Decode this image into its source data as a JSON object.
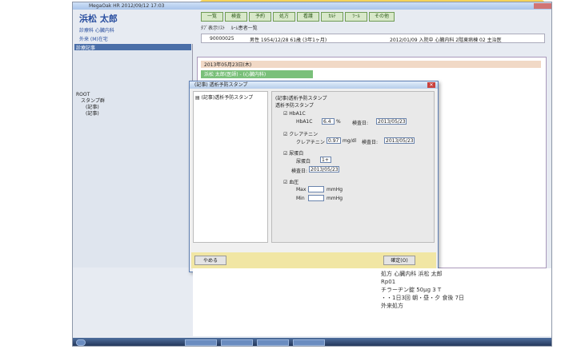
{
  "window": {
    "title": "MegaOak HR  2012/09/12 17:03"
  },
  "patient": {
    "name": "浜松 太郎",
    "dept": "診療科 心臓内科",
    "sub": "外来 (M)在宅"
  },
  "tabs": [
    "一覧",
    "検査",
    "予約",
    "処方",
    "看護",
    "ｶﾙﾃ",
    "ﾂｰﾙ",
    "その他"
  ],
  "row2": {
    "a": "ﾀﾌﾞ表示ﾘｽﾄ",
    "b": "ﾙｰﾑ患者一覧"
  },
  "patientbar": {
    "id": "90000025",
    "info": "男性 1954/12/28 61歳 (3年1ヶ月)",
    "extra": "2012/01/09 入院中  心臓内科 2階東病棟 02  主治医"
  },
  "left": {
    "header": "診療記事",
    "tree": [
      "ROOT",
      "スタンプ群",
      "(記事)",
      "(記事)"
    ]
  },
  "editor": {
    "date": "2013年05月23日(木)",
    "tab": "浜松 太郎(医師) - (心臓内科)"
  },
  "dialog": {
    "title": "(記事) 透析予防スタンプ",
    "tree_item": "(記事)透析予防スタンプ",
    "form_title": "(記事)透析予防スタンプ",
    "section": "透析予防スタンプ",
    "hba1c_label": "HbA1C",
    "hba1c_sub": "HbA1C",
    "hba1c_val": "6.4",
    "hba1c_unit": "%",
    "exam_label": "検査日:",
    "hba1c_date": "2013/05/23",
    "cre_label": "クレアチニン",
    "cre_sub": "クレアチニン",
    "cre_val": "0.97",
    "cre_unit": "mg/dl",
    "cre_date": "2013/05/23",
    "urine_label": "尿蛋白",
    "urine_sub": "尿蛋白",
    "urine_val": "1+",
    "urine_date": "2013/05/23",
    "bp_label": "血圧",
    "max_label": "Max",
    "min_label": "Min",
    "bp_unit": "mmHg",
    "cancel": "やめる",
    "confirm": "確定(O)"
  },
  "prescription": {
    "lines": [
      "処方  心臓内科  浜松 太郎",
      "Rp01",
      "チラーヂン錠 50μg   3 T",
      "・・1日3回 朝・昼・夕 食後   7日",
      "外来処方"
    ]
  },
  "colors": {
    "accent": "#4a6ea8",
    "highlight": "#f5d35a",
    "footer": "#f1e6a4"
  }
}
